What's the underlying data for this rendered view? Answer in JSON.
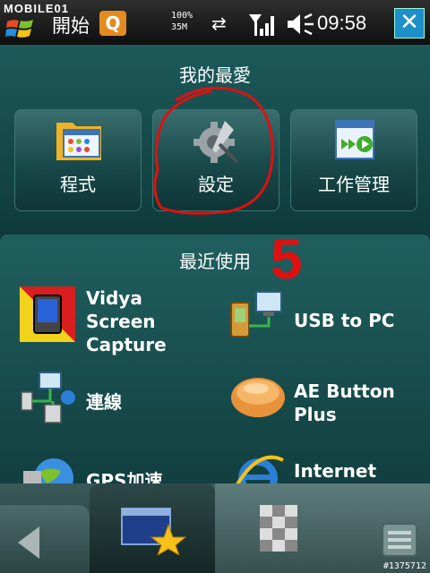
{
  "status": {
    "brand": "MOBILE01",
    "start_label": "開始",
    "q_badge": "Q",
    "mem_top": "100%",
    "mem_bottom": "35M",
    "time": "09:58",
    "close_label": "✕"
  },
  "favorites": {
    "title": "我的最愛",
    "tiles": [
      {
        "label": "程式"
      },
      {
        "label": "設定"
      },
      {
        "label": "工作管理"
      }
    ]
  },
  "recent": {
    "title": "最近使用",
    "items": [
      {
        "label_lines": [
          "Vidya",
          "Screen",
          "Capture"
        ]
      },
      {
        "label_lines": [
          "USB to PC"
        ]
      },
      {
        "label_lines": [
          "連線"
        ]
      },
      {
        "label_lines": [
          "AE Button",
          "Plus"
        ]
      },
      {
        "label_lines": [
          "GPS加速"
        ]
      },
      {
        "label_lines": [
          "Internet"
        ]
      }
    ]
  },
  "annotation": {
    "number": "5",
    "color": "#e01010"
  },
  "watermark": "#1375712",
  "colors": {
    "panel": "#1d5a5a",
    "accent_close": "#1e8fc8",
    "badge_orange": "#e38b1f"
  }
}
